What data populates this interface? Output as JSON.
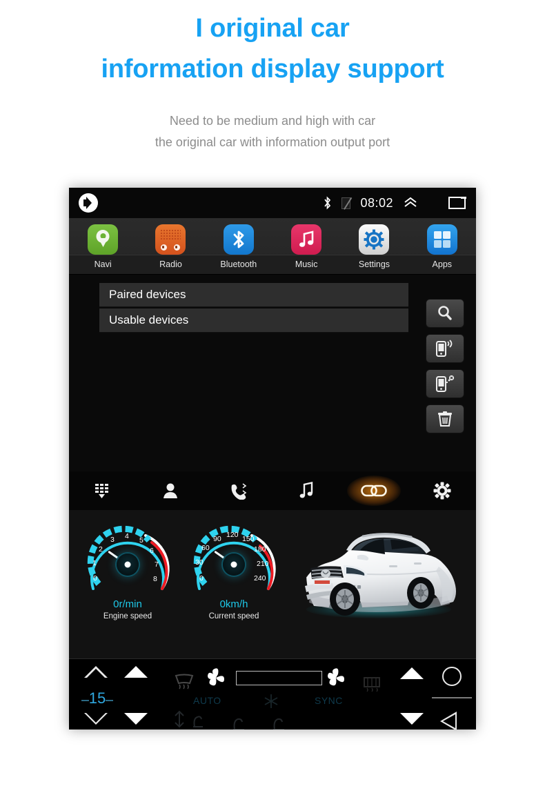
{
  "header": {
    "headline_line1": "I original car",
    "headline_line2": "information display support",
    "headline_color": "#17a2f3",
    "sub_line1": "Need to be medium and high with car",
    "sub_line2": "the original car with information output port",
    "sub_color": "#8c8c8c"
  },
  "device": {
    "statusbar": {
      "volume_icon": "speaker-icon",
      "bluetooth_icon": "bluetooth-icon",
      "signal_icon": "no-signal-icon",
      "time": "08:02",
      "chevron_icon": "chevron-up-icon",
      "recents_icon": "recents-icon"
    },
    "dock": {
      "items": [
        {
          "label": "Navi",
          "icon": "navi-icon",
          "color": "#6cb336"
        },
        {
          "label": "Radio",
          "icon": "radio-icon",
          "color": "#de6323"
        },
        {
          "label": "Bluetooth",
          "icon": "bluetooth-icon",
          "color": "#1e89dc"
        },
        {
          "label": "Music",
          "icon": "music-icon",
          "color": "#dc275c"
        },
        {
          "label": "Settings",
          "icon": "settings-gear-icon",
          "color": "#e6e6e6"
        },
        {
          "label": "Apps",
          "icon": "apps-grid-icon",
          "color": "#1d8ce0"
        }
      ]
    },
    "bluetooth_panel": {
      "lists": [
        {
          "label": "Paired devices"
        },
        {
          "label": "Usable devices"
        }
      ],
      "side_buttons": [
        {
          "name": "search-button",
          "icon": "search-icon"
        },
        {
          "name": "connect-device-button",
          "icon": "phone-connect-icon"
        },
        {
          "name": "disconnect-device-button",
          "icon": "phone-disconnect-icon"
        },
        {
          "name": "delete-button",
          "icon": "trash-icon"
        }
      ]
    },
    "function_bar": {
      "items": [
        {
          "name": "dialpad-tab",
          "icon": "dialpad-icon",
          "active": false
        },
        {
          "name": "contacts-tab",
          "icon": "contact-person-icon",
          "active": false
        },
        {
          "name": "call-history-tab",
          "icon": "phone-handset-icon",
          "active": false
        },
        {
          "name": "bt-music-tab",
          "icon": "music-note-icon",
          "active": false
        },
        {
          "name": "link-tab",
          "icon": "link-chain-icon",
          "active": true
        },
        {
          "name": "bt-settings-tab",
          "icon": "gear-icon",
          "active": false
        }
      ],
      "active_glow_color": "#ff9614"
    },
    "cluster": {
      "tachometer": {
        "value_label": "0r/min",
        "caption": "Engine speed",
        "ticks": [
          "0",
          "1",
          "2",
          "3",
          "4",
          "5",
          "6",
          "7",
          "8"
        ],
        "redline_from": 6,
        "max": 8
      },
      "speedometer": {
        "value_label": "0km/h",
        "caption": "Current speed",
        "ticks": [
          "0",
          "30",
          "60",
          "90",
          "120",
          "150",
          "180",
          "210",
          "240"
        ],
        "redline_from": 180,
        "max": 240
      },
      "vehicle_image": "white-suv-illustration",
      "accent_color": "#1ec8e8"
    },
    "climate_bar": {
      "temperature": "15",
      "temperature_color": "#2fa8e0",
      "auto_label": "AUTO",
      "sync_label": "SYNC",
      "controls": [
        {
          "name": "volume-up-outline-button",
          "icon": "triangle-up-outline-icon"
        },
        {
          "name": "volume-down-outline-button",
          "icon": "triangle-down-outline-icon"
        },
        {
          "name": "temp-up-button",
          "icon": "triangle-up-filled-icon"
        },
        {
          "name": "temp-down-button",
          "icon": "triangle-down-filled-icon"
        },
        {
          "name": "front-defrost-button",
          "icon": "front-defrost-icon"
        },
        {
          "name": "fan-left-button",
          "icon": "fan-icon"
        },
        {
          "name": "airflow-mode-button",
          "icon": "airflow-seat-icon"
        },
        {
          "name": "fan-speed-slider",
          "icon": "slider-icon"
        },
        {
          "name": "ac-button",
          "icon": "snowflake-icon"
        },
        {
          "name": "fan-right-button",
          "icon": "fan-icon"
        },
        {
          "name": "rear-defrost-button",
          "icon": "rear-defrost-icon"
        },
        {
          "name": "nav-up-button",
          "icon": "triangle-up-filled-icon"
        },
        {
          "name": "nav-down-button",
          "icon": "triangle-down-filled-icon"
        },
        {
          "name": "home-button",
          "icon": "circle-icon"
        },
        {
          "name": "menu-button",
          "icon": "horizontal-line-icon"
        },
        {
          "name": "back-button",
          "icon": "triangle-left-outline-icon"
        }
      ]
    }
  }
}
